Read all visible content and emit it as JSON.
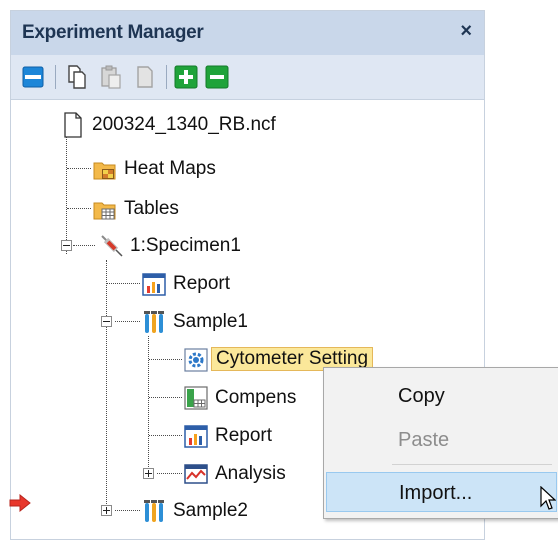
{
  "panel": {
    "title": "Experiment Manager",
    "close_glyph": "×"
  },
  "toolbar": {
    "buttons": [
      {
        "icon": "layout-panel-icon"
      },
      {
        "icon": "copy-icon"
      },
      {
        "icon": "paste-icon"
      },
      {
        "icon": "document-icon"
      },
      {
        "icon": "add-icon"
      },
      {
        "icon": "remove-icon"
      }
    ]
  },
  "tree": {
    "root": {
      "label": "200324_1340_RB.ncf"
    },
    "heat_maps": {
      "label": "Heat Maps"
    },
    "tables": {
      "label": "Tables"
    },
    "specimen1": {
      "label": "1:Specimen1"
    },
    "specimen_report": {
      "label": "Report"
    },
    "sample1": {
      "label": "Sample1"
    },
    "cytometer_setting": {
      "label": "Cytometer Setting"
    },
    "compensation": {
      "label": "Compens"
    },
    "sample_report": {
      "label": "Report"
    },
    "analysis": {
      "label": "Analysis"
    },
    "sample2": {
      "label": "Sample2"
    }
  },
  "context_menu": {
    "copy": "Copy",
    "paste": "Paste",
    "import": "Import..."
  },
  "colors": {
    "title_bar": "#c9d7ea",
    "toolbar": "#dfe7f3",
    "selection": "#fbe89a",
    "menu_hover": "#cce4f7",
    "arrow": "#e8372c"
  }
}
